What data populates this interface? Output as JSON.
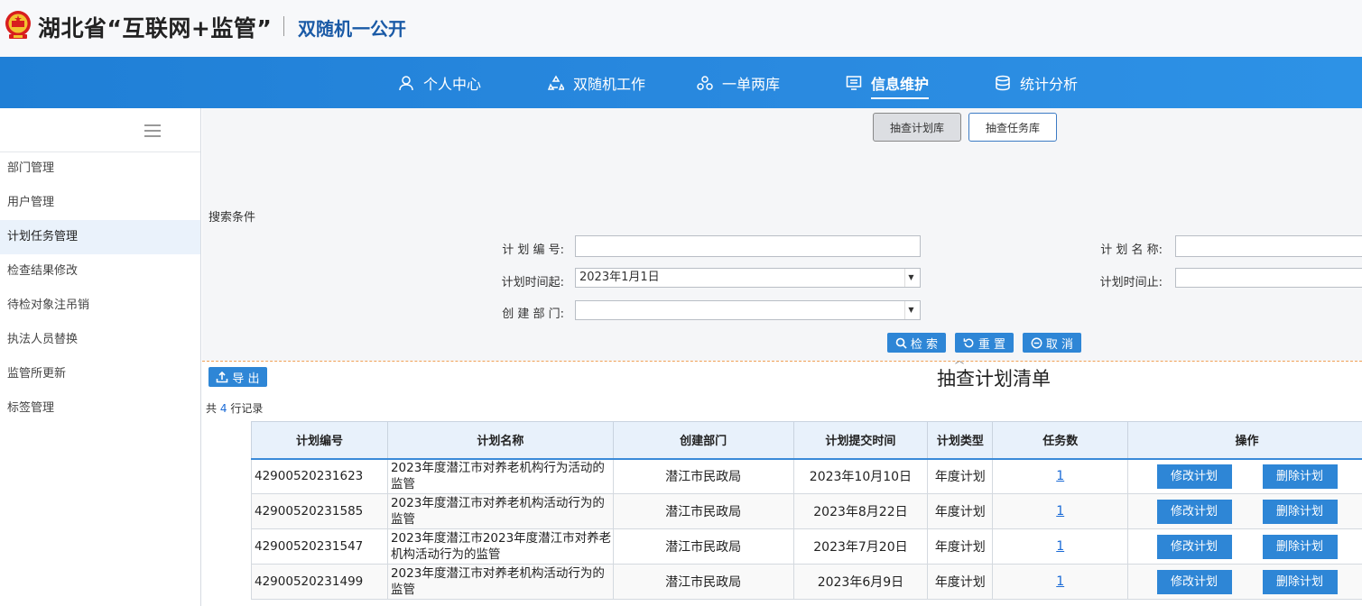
{
  "header": {
    "site_title": "湖北省“互联网+监管”",
    "sub_title": "双随机一公开"
  },
  "nav": [
    {
      "label": "个人中心",
      "icon": "user-icon"
    },
    {
      "label": "双随机工作",
      "icon": "recycle-icon"
    },
    {
      "label": "一单两库",
      "icon": "group-icon"
    },
    {
      "label": "信息维护",
      "icon": "monitor-list-icon",
      "active": true
    },
    {
      "label": "统计分析",
      "icon": "database-icon"
    }
  ],
  "sidebar": {
    "items": [
      {
        "label": "部门管理"
      },
      {
        "label": "用户管理"
      },
      {
        "label": "计划任务管理",
        "active": true
      },
      {
        "label": "检查结果修改"
      },
      {
        "label": "待检对象注吊销"
      },
      {
        "label": "执法人员替换"
      },
      {
        "label": "监管所更新"
      },
      {
        "label": "标签管理"
      }
    ]
  },
  "tabs": [
    {
      "label": "抽查计划库",
      "active": true
    },
    {
      "label": "抽查任务库"
    }
  ],
  "search": {
    "caption": "搜索条件",
    "plan_no_label": "计 划 编 号:",
    "plan_no_value": "",
    "plan_name_label": "计 划 名 称:",
    "plan_name_value": "",
    "time_from_label": "计划时间起:",
    "time_from_value": "2023年1月1日",
    "time_to_label": "计划时间止:",
    "time_to_value": "",
    "dept_label": "创 建 部 门:",
    "dept_value": "",
    "search_btn": "检 索",
    "reset_btn": "重 置",
    "cancel_btn": "取 消"
  },
  "list": {
    "export_btn": "导 出",
    "title": "抽查计划清单",
    "count_prefix": "共",
    "count": "4",
    "count_suffix": "行记录",
    "columns": [
      "计划编号",
      "计划名称",
      "创建部门",
      "计划提交时间",
      "计划类型",
      "任务数",
      "操作"
    ],
    "edit_btn": "修改计划",
    "delete_btn": "删除计划",
    "rows": [
      {
        "no": "42900520231623",
        "name": "2023年度潜江市对养老机构行为活动的监管",
        "dept": "潜江市民政局",
        "time": "2023年10月10日",
        "type": "年度计划",
        "tasks": "1"
      },
      {
        "no": "42900520231585",
        "name": "2023年度潜江市对养老机构活动行为的监管",
        "dept": "潜江市民政局",
        "time": "2023年8月22日",
        "type": "年度计划",
        "tasks": "1"
      },
      {
        "no": "42900520231547",
        "name": "2023年度潜江市2023年度潜江市对养老机构活动行为的监管",
        "dept": "潜江市民政局",
        "time": "2023年7月20日",
        "type": "年度计划",
        "tasks": "1"
      },
      {
        "no": "42900520231499",
        "name": "2023年度潜江市对养老机构活动行为的监管",
        "dept": "潜江市民政局",
        "time": "2023年6月9日",
        "type": "年度计划",
        "tasks": "1"
      }
    ]
  }
}
